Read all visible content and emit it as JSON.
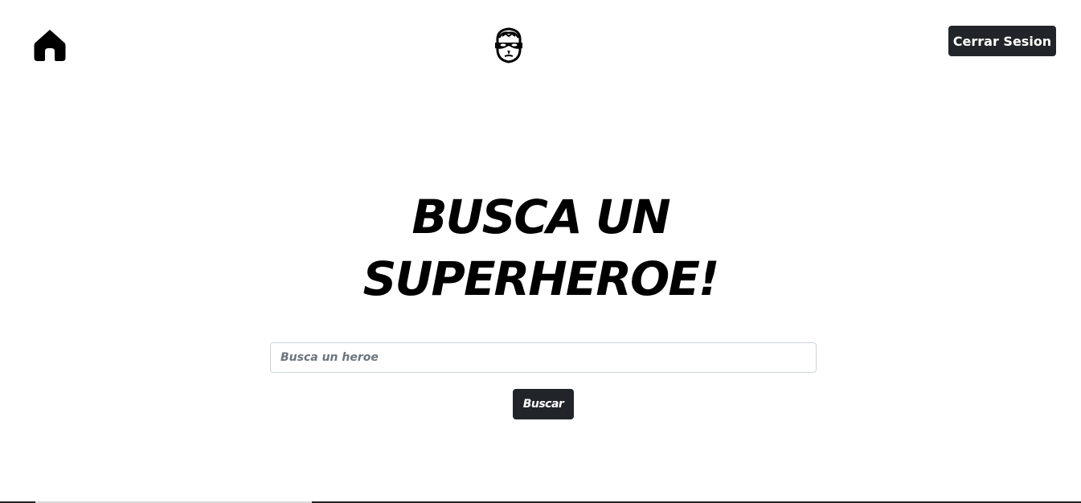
{
  "header": {
    "home_icon": "home-icon",
    "logo_icon": "masked-hero-face-icon",
    "logout_label": "Cerrar Sesion"
  },
  "main": {
    "title_line1": "BUSCA UN",
    "title_line2": "SUPERHEROE!",
    "search": {
      "placeholder": "Busca un heroe",
      "value": ""
    },
    "search_button_label": "Buscar"
  },
  "colors": {
    "button_bg": "#212529",
    "button_text": "#ffffff",
    "input_border": "#ced4da",
    "placeholder": "#6c757d",
    "background": "#ffffff"
  }
}
